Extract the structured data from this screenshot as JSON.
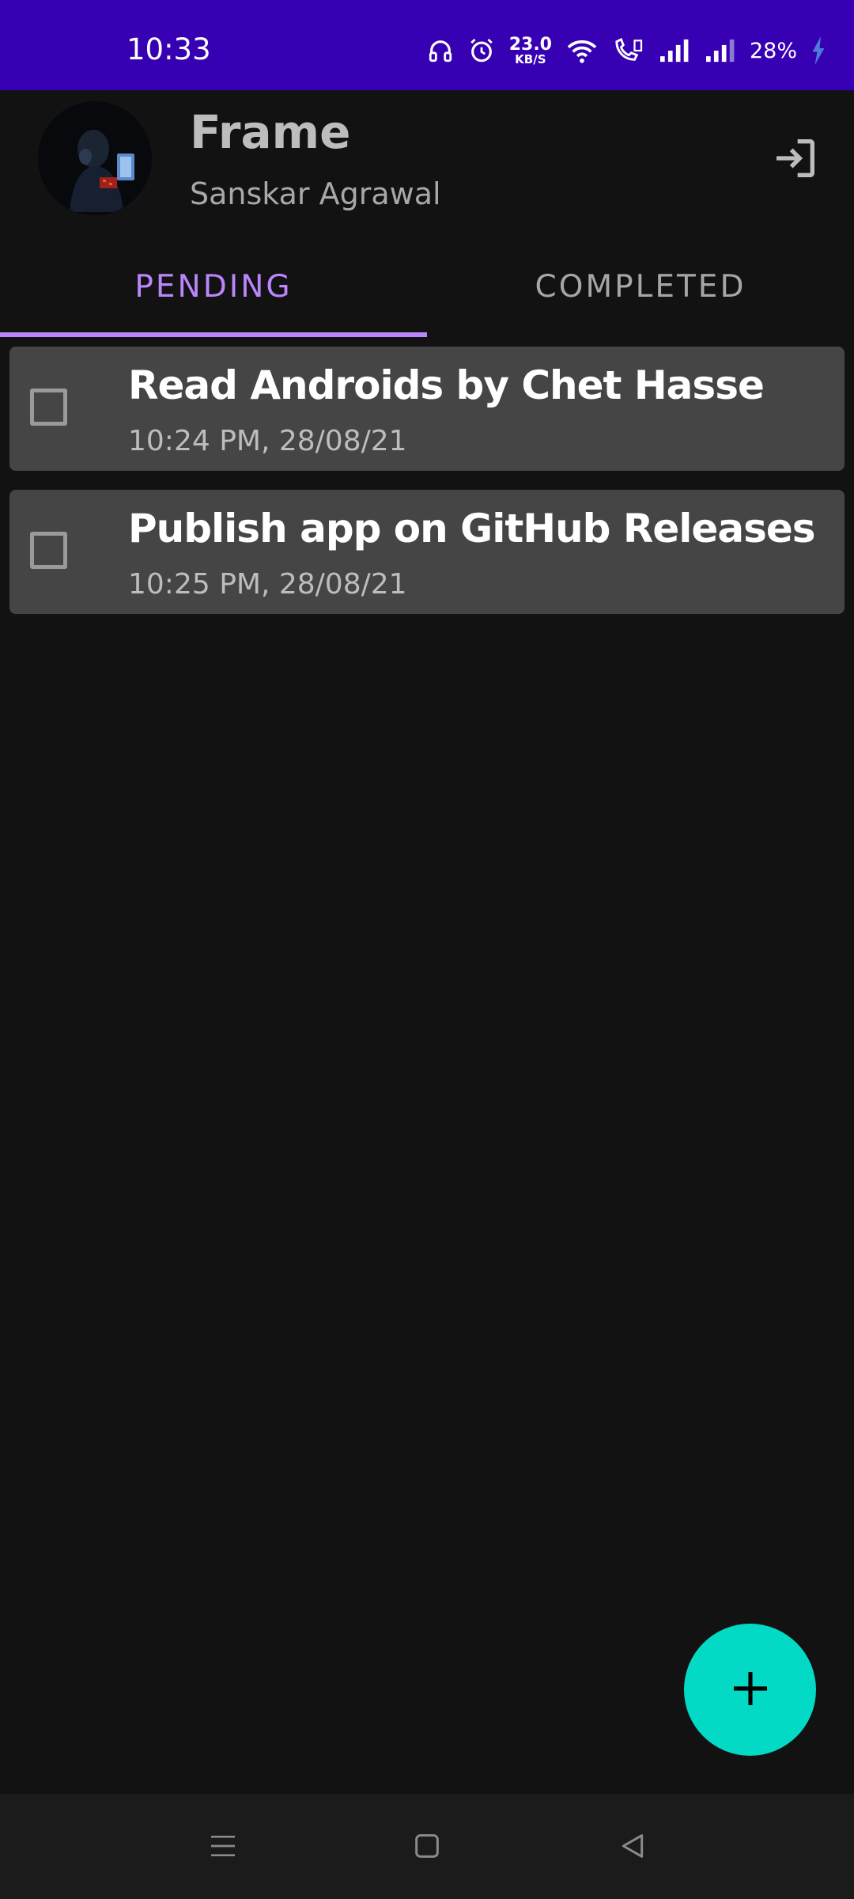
{
  "status_bar": {
    "time": "10:33",
    "net_speed_value": "23.0",
    "net_speed_unit": "KB/S",
    "battery_percent": "28%",
    "icons": [
      "headphones-icon",
      "alarm-icon",
      "wifi-icon",
      "volte-call-icon",
      "signal-icon",
      "signal-icon",
      "charging-icon"
    ]
  },
  "header": {
    "app_title": "Frame",
    "user_name": "Sanskar Agrawal",
    "logout_icon": "logout-icon"
  },
  "tabs": [
    {
      "label": "PENDING",
      "selected": true
    },
    {
      "label": "COMPLETED",
      "selected": false
    }
  ],
  "tasks": [
    {
      "title": "Read Androids by Chet Hasse",
      "time": "10:24 PM, 28/08/21",
      "checked": false
    },
    {
      "title": "Publish app on GitHub Releases",
      "time": "10:25 PM, 28/08/21",
      "checked": false
    }
  ],
  "fab": {
    "icon": "plus-icon"
  },
  "nav_bar": {
    "buttons": [
      "menu-icon",
      "home-icon",
      "back-icon"
    ]
  },
  "colors": {
    "status_bar": "#3700b3",
    "background": "#121212",
    "accent": "#bb86fc",
    "card": "#454545",
    "fab": "#03dac5"
  }
}
